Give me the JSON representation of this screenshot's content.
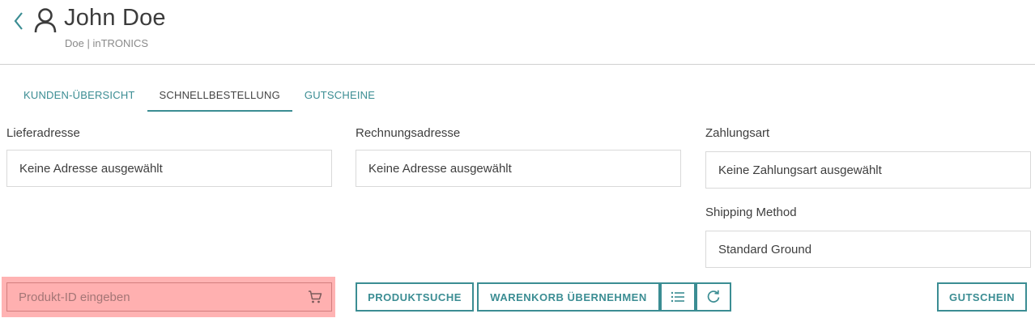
{
  "header": {
    "customer_name": "John Doe",
    "customer_sub": "Doe | inTRONICS"
  },
  "tabs": [
    {
      "label": "KUNDEN-ÜBERSICHT",
      "active": false
    },
    {
      "label": "SCHNELLBESTELLUNG",
      "active": true
    },
    {
      "label": "GUTSCHEINE",
      "active": false
    }
  ],
  "delivery": {
    "label": "Lieferadresse",
    "value": "Keine Adresse ausgewählt"
  },
  "billing": {
    "label": "Rechnungsadresse",
    "value": "Keine Adresse ausgewählt"
  },
  "payment": {
    "label": "Zahlungsart",
    "value": "Keine Zahlungsart ausgewählt"
  },
  "shipping": {
    "label": "Shipping Method",
    "value": "Standard Ground"
  },
  "product_input": {
    "placeholder": "Produkt-ID eingeben",
    "value": ""
  },
  "buttons": {
    "product_search": "PRODUKTSUCHE",
    "take_cart": "WARENKORB ÜBERNEHMEN",
    "voucher": "GUTSCHEIN"
  },
  "colors": {
    "accent": "#3b8d93",
    "highlight": "#ffb3b3"
  },
  "icons": [
    "chevron-left-icon",
    "user-icon",
    "cart-icon",
    "list-icon",
    "refresh-icon"
  ]
}
